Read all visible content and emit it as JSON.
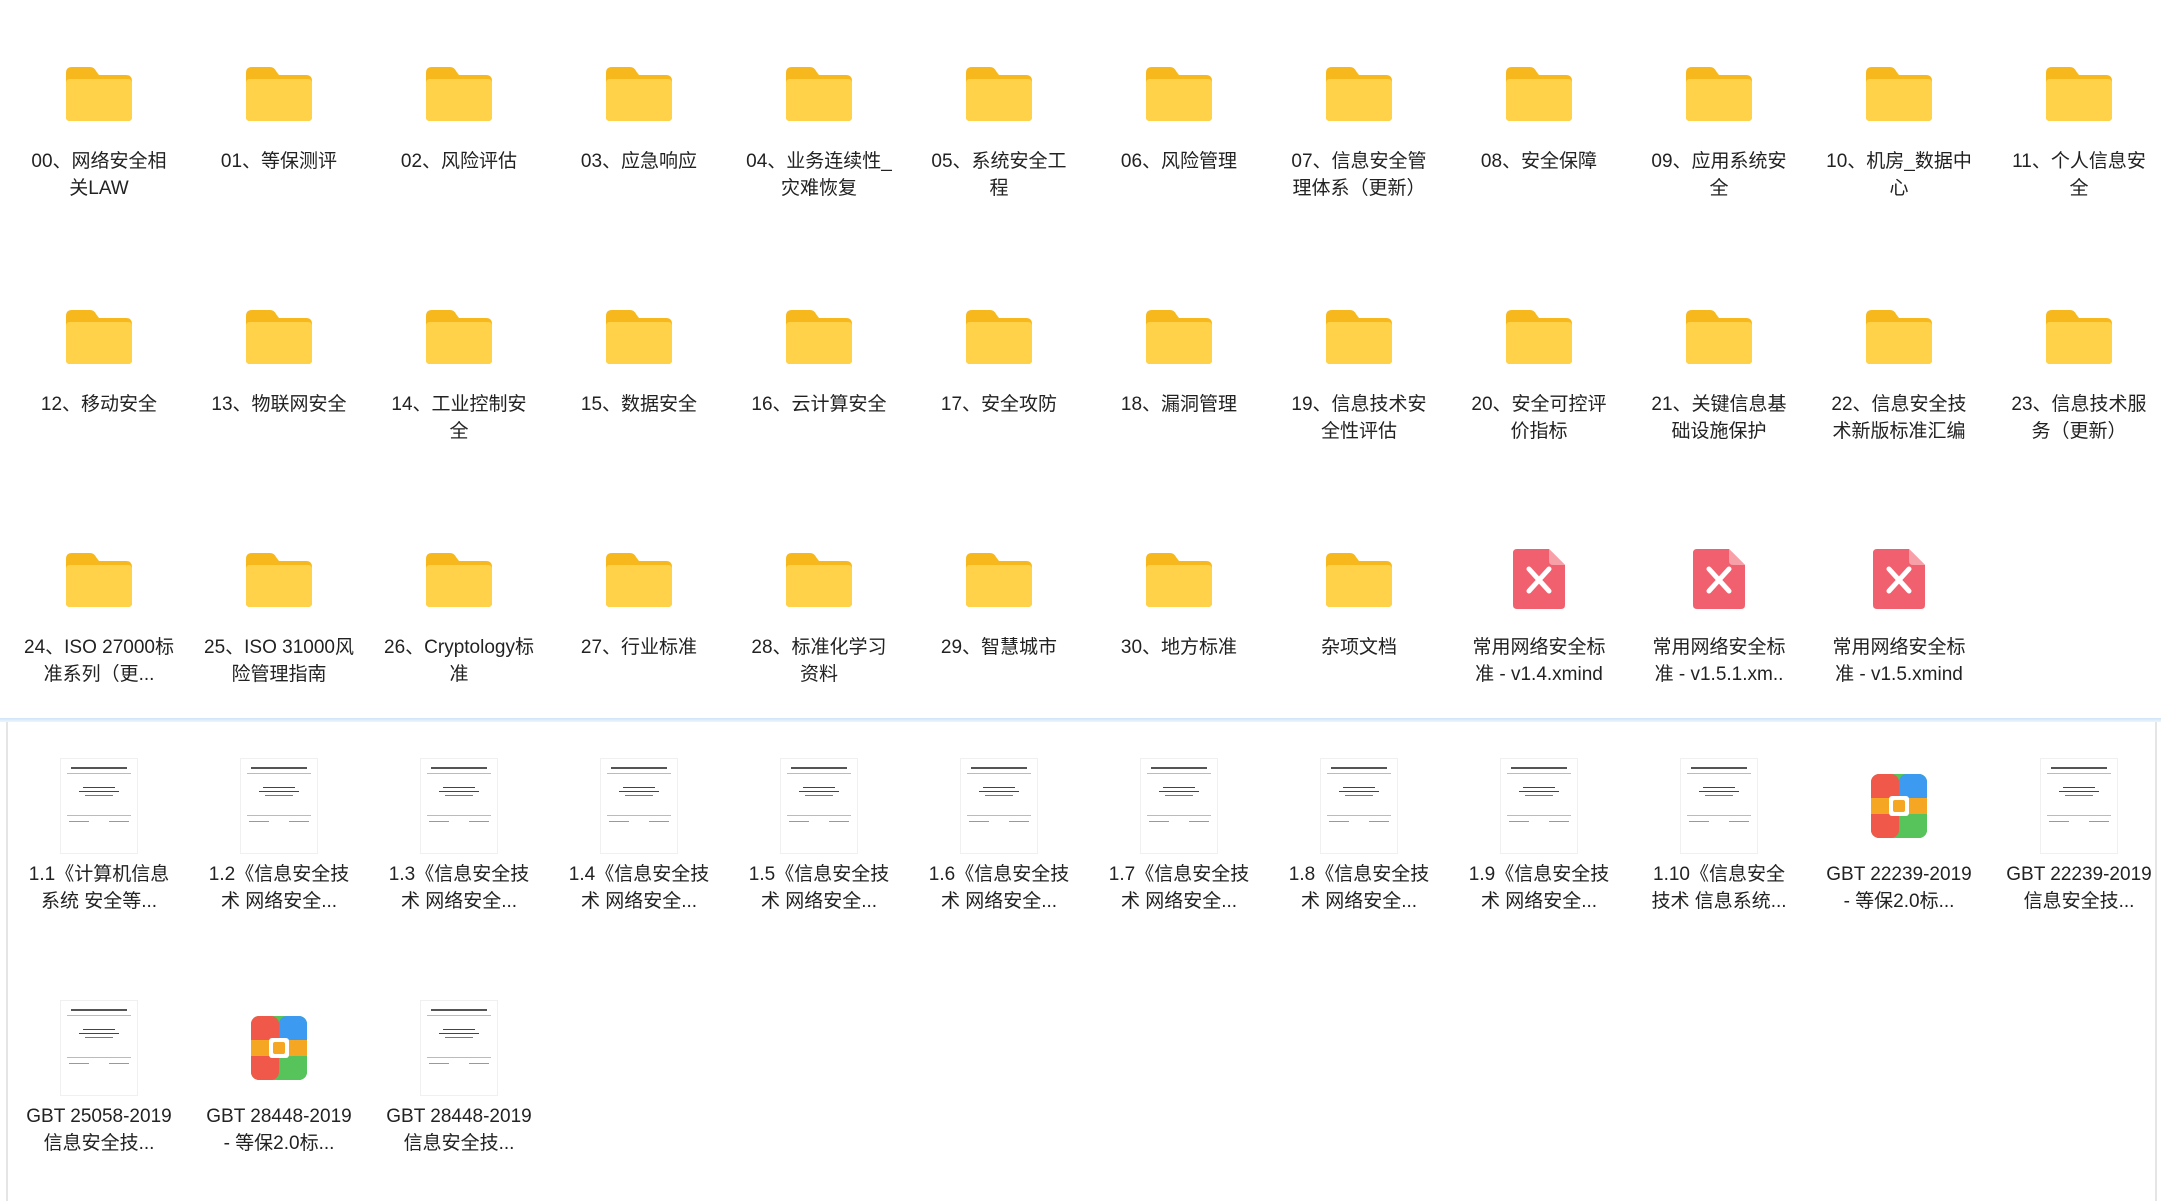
{
  "folders_row1": [
    {
      "label": "00、网络安全相关LAW",
      "icon": "folder-icon"
    },
    {
      "label": "01、等保测评",
      "icon": "folder-icon"
    },
    {
      "label": "02、风险评估",
      "icon": "folder-icon"
    },
    {
      "label": "03、应急响应",
      "icon": "folder-icon"
    },
    {
      "label": "04、业务连续性_灾难恢复",
      "icon": "folder-icon"
    },
    {
      "label": "05、系统安全工程",
      "icon": "folder-icon"
    },
    {
      "label": "06、风险管理",
      "icon": "folder-icon"
    },
    {
      "label": "07、信息安全管理体系（更新）",
      "icon": "folder-icon"
    },
    {
      "label": "08、安全保障",
      "icon": "folder-icon"
    },
    {
      "label": "09、应用系统安全",
      "icon": "folder-icon"
    },
    {
      "label": "10、机房_数据中心",
      "icon": "folder-icon"
    },
    {
      "label": "11、个人信息安全",
      "icon": "folder-icon"
    }
  ],
  "folders_row2": [
    {
      "label": "12、移动安全",
      "icon": "folder-icon"
    },
    {
      "label": "13、物联网安全",
      "icon": "folder-icon"
    },
    {
      "label": "14、工业控制安全",
      "icon": "folder-icon"
    },
    {
      "label": "15、数据安全",
      "icon": "folder-icon"
    },
    {
      "label": "16、云计算安全",
      "icon": "folder-icon"
    },
    {
      "label": "17、安全攻防",
      "icon": "folder-icon"
    },
    {
      "label": "18、漏洞管理",
      "icon": "folder-icon"
    },
    {
      "label": "19、信息技术安全性评估",
      "icon": "folder-icon"
    },
    {
      "label": "20、安全可控评价指标",
      "icon": "folder-icon"
    },
    {
      "label": "21、关键信息基础设施保护",
      "icon": "folder-icon"
    },
    {
      "label": "22、信息安全技术新版标准汇编",
      "icon": "folder-icon"
    },
    {
      "label": "23、信息技术服务（更新）",
      "icon": "folder-icon"
    }
  ],
  "folders_row3": [
    {
      "label": "24、ISO 27000标准系列（更...",
      "icon": "folder-icon"
    },
    {
      "label": "25、ISO 31000风险管理指南",
      "icon": "folder-icon"
    },
    {
      "label": "26、Cryptology标准",
      "icon": "folder-icon"
    },
    {
      "label": "27、行业标准",
      "icon": "folder-icon"
    },
    {
      "label": "28、标准化学习资料",
      "icon": "folder-icon"
    },
    {
      "label": "29、智慧城市",
      "icon": "folder-icon"
    },
    {
      "label": "30、地方标准",
      "icon": "folder-icon"
    },
    {
      "label": "杂项文档",
      "icon": "folder-icon"
    },
    {
      "label": "常用网络安全标准 - v1.4.xmind",
      "icon": "xmind-file-icon"
    },
    {
      "label": "常用网络安全标准 - v1.5.1.xm..",
      "icon": "xmind-file-icon"
    },
    {
      "label": "常用网络安全标准 - v1.5.xmind",
      "icon": "xmind-file-icon"
    }
  ],
  "files_row1": [
    {
      "label": "1.1《计算机信息系统 安全等...",
      "icon": "pdf-thumbnail-icon"
    },
    {
      "label": "1.2《信息安全技术 网络安全...",
      "icon": "pdf-thumbnail-icon"
    },
    {
      "label": "1.3《信息安全技术 网络安全...",
      "icon": "pdf-thumbnail-icon"
    },
    {
      "label": "1.4《信息安全技术 网络安全...",
      "icon": "pdf-thumbnail-icon"
    },
    {
      "label": "1.5《信息安全技术 网络安全...",
      "icon": "pdf-thumbnail-icon"
    },
    {
      "label": "1.6《信息安全技术 网络安全...",
      "icon": "pdf-thumbnail-icon"
    },
    {
      "label": "1.7《信息安全技术 网络安全...",
      "icon": "pdf-thumbnail-icon"
    },
    {
      "label": "1.8《信息安全技术 网络安全...",
      "icon": "pdf-thumbnail-icon"
    },
    {
      "label": "1.9《信息安全技术 网络安全...",
      "icon": "pdf-thumbnail-icon"
    },
    {
      "label": "1.10《信息安全技术 信息系统...",
      "icon": "pdf-thumbnail-icon"
    },
    {
      "label": "GBT 22239-2019 - 等保2.0标...",
      "icon": "archive-file-icon"
    },
    {
      "label": "GBT 22239-2019 信息安全技...",
      "icon": "pdf-thumbnail-icon"
    }
  ],
  "files_row2": [
    {
      "label": "GBT 25058-2019 信息安全技...",
      "icon": "pdf-thumbnail-icon"
    },
    {
      "label": "GBT 28448-2019 - 等保2.0标...",
      "icon": "archive-file-icon"
    },
    {
      "label": "GBT 28448-2019 信息安全技...",
      "icon": "pdf-thumbnail-icon"
    }
  ],
  "colors": {
    "folder_back": "#F6B81C",
    "folder_front": "#FFD24A",
    "xmind_red": "#F0606E",
    "archive_top": "#3C9AF0",
    "archive_orange": "#F5A623",
    "archive_green": "#56C45A",
    "archive_red": "#F0584A"
  }
}
